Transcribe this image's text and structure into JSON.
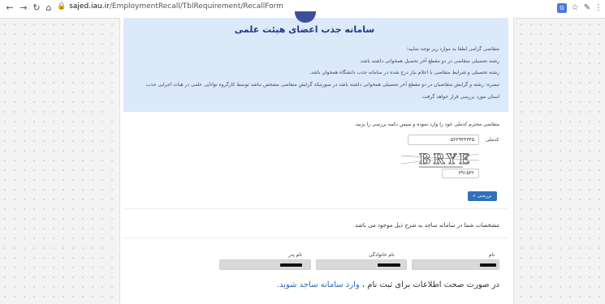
{
  "browser": {
    "back_icon": "←",
    "forward_icon": "→",
    "reload_icon": "↻",
    "home_icon": "⌂",
    "lock_icon": "🔒",
    "url_host": "sajed.iau.ir",
    "url_path": "/EmploymentRecall/TblRequirement/RecallForm",
    "translate_icon": "G",
    "star_icon": "☆",
    "ext_icon": "✎",
    "menu_icon": "⋮"
  },
  "page": {
    "title": "سامانه جذب اعضای هیئت علمی",
    "notes": [
      "متقاضی گرامی لطفا به موارد زیر توجه نمایید:",
      "رشته تحصیلی متقاضی در دو مقطع آخر تحصیل همخوانی داشته باشد.",
      "رشته تحصیلی و شرایط متقاضی با اعلام نیاز درج شده در سامانه جذب دانشگاه همخوان باشد.",
      "تبصره: رشته و گرایش متقاضیان در دو مقطع آخر تحصیلی همخوانی داشته باشد در صورتیکه گرایش متقاضی مشخص نباشد توسط کارگروه توانایی علمی در هیات اجرایی جذب",
      "استان مورد بررسی قرار خواهد گرفت."
    ],
    "instruction": "متقاضی محترم کدملی خود را وارد نموده و سپس دکمه بررسی را بزنید.",
    "national_code_label": "کدملی",
    "national_code_value": "۰۵۲۲۹۴۴۳۴۵",
    "captcha_text": "BRYE",
    "captcha_input_value": "۳۹۱۵۳۲",
    "check_button": "بررسی",
    "info_text": "مشخصات شما در سامانه ساجد به شرح ذیل موجود می باشد.",
    "name_label": "نام",
    "lastname_label": "نام خانوادگی",
    "father_label": "نام پدر",
    "footer_text": "در صورت صحت اطلاعات برای ثبت نام ،",
    "footer_link": "وارد سامانه ساجد شوید."
  }
}
